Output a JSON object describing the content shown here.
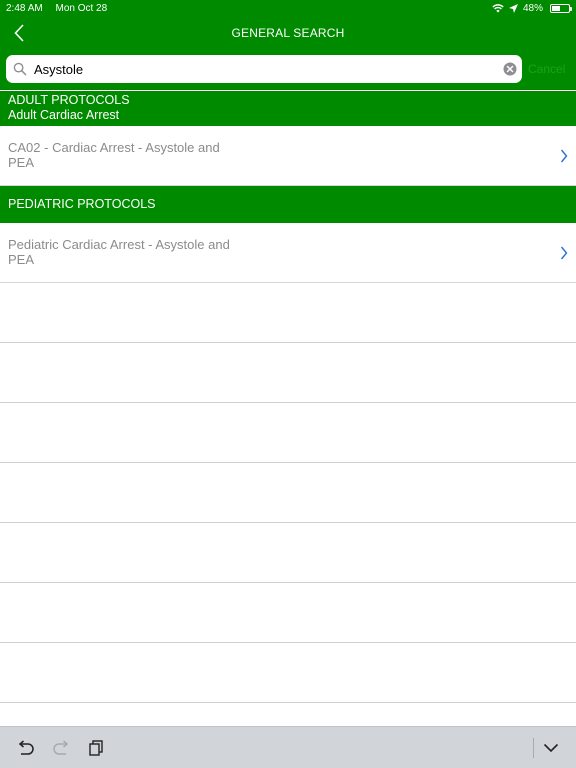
{
  "status_bar": {
    "time": "2:48 AM",
    "date": "Mon Oct 28",
    "battery": "48%",
    "battery_level": 0.48,
    "icons": [
      "wifi-icon",
      "location-arrow-icon",
      "battery-icon"
    ]
  },
  "nav": {
    "title": "GENERAL SEARCH",
    "back_icon": "chevron-left-icon"
  },
  "search": {
    "value": "Asystole",
    "placeholder": "",
    "cancel_label": "Cancel"
  },
  "sections": [
    {
      "title": "ADULT PROTOCOLS",
      "subtitle": "Adult Cardiac Arrest",
      "results": [
        {
          "label": "CA02 - Cardiac Arrest - Asystole and PEA"
        }
      ]
    },
    {
      "title": "PEDIATRIC PROTOCOLS",
      "results": [
        {
          "label": "Pediatric Cardiac Arrest - Asystole and PEA"
        }
      ]
    }
  ],
  "toolbar": {
    "icons": [
      "undo-icon",
      "redo-icon",
      "paste-icon",
      "keyboard-dismiss-icon"
    ]
  },
  "colors": {
    "header_green": "#008a00",
    "result_text": "#8b8b8b",
    "chevron_blue": "#2a6fd6",
    "toolbar_bg": "#d1d4d9"
  }
}
